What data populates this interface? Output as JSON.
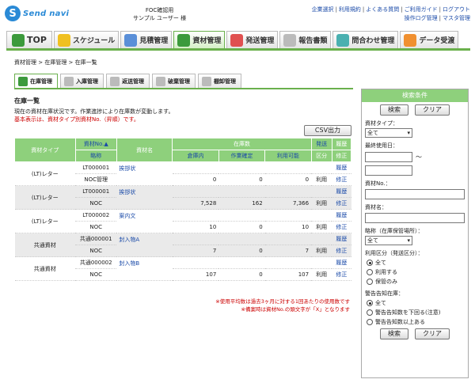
{
  "app": {
    "logo_mark": "S",
    "logo_text": "Send navi"
  },
  "user": {
    "line1": "FOC確認用",
    "line2": "サンプル ユーザー 様"
  },
  "toplinks": {
    "row1": [
      "企業選択",
      "利用規約",
      "よくある質問",
      "ご利用ガイド",
      "ログアウト"
    ],
    "row2": [
      "操作ログ管理",
      "マスタ管理"
    ]
  },
  "main_tabs": [
    "TOP",
    "スケジュール",
    "見積管理",
    "資材管理",
    "発送管理",
    "報告書類",
    "問合わせ管理",
    "データ受渡"
  ],
  "breadcrumb": "資材管理 > 在庫管理 > 在庫一覧",
  "sub_tabs": [
    "在庫管理",
    "入庫管理",
    "返送管理",
    "破棄管理",
    "棚卸管理"
  ],
  "section": {
    "title": "在庫一覧",
    "desc1": "現在の資材在庫状況です。作業進捗により在庫数が変動します。",
    "desc2": "基本表示は、資材タイプ別資材No.（昇順）です。",
    "csv_label": "CSV出力"
  },
  "table": {
    "h_type": "資材タイプ",
    "h_no": "資材No.▲",
    "h_abbr": "略称",
    "h_name": "資材名",
    "h_stock": "在庫数",
    "h_warehouse": "倉庫内",
    "h_confirmed": "作業確定",
    "h_available": "利用可能",
    "h_ship1": "発送",
    "h_ship2": "区分",
    "h_hist1": "履歴",
    "h_hist2": "修正",
    "rows": [
      {
        "type": "(LT)レター",
        "no": "LT000001",
        "abbr": "NOC管理",
        "name": "挨拶状",
        "warehouse": "0",
        "confirmed": "0",
        "available": "0",
        "ship": "利用",
        "hist": "履歴",
        "edit": "修正"
      },
      {
        "type": "(LT)レター",
        "no": "LT000001",
        "abbr": "NOC",
        "name": "挨拶状",
        "warehouse": "7,528",
        "confirmed": "162",
        "available": "7,366",
        "ship": "利用",
        "hist": "履歴",
        "edit": "修正"
      },
      {
        "type": "(LT)レター",
        "no": "LT000002",
        "abbr": "NOC",
        "name": "案内文",
        "warehouse": "10",
        "confirmed": "0",
        "available": "10",
        "ship": "利用",
        "hist": "履歴",
        "edit": "修正"
      },
      {
        "type": "共通資材",
        "no": "共通000001",
        "abbr": "NOC",
        "name": "封入物A",
        "warehouse": "7",
        "confirmed": "0",
        "available": "7",
        "ship": "利用",
        "hist": "履歴",
        "edit": "修正"
      },
      {
        "type": "共通資材",
        "no": "共通000002",
        "abbr": "NOC",
        "name": "封入物B",
        "warehouse": "107",
        "confirmed": "0",
        "available": "107",
        "ship": "利用",
        "hist": "履歴",
        "edit": "修正"
      }
    ]
  },
  "footnote": {
    "line1": "※使用平均数は過去3ヶ月に対する1回あたりの使用数です",
    "line2": "※備案時は資材No.の頭文字が「X」となります"
  },
  "side": {
    "title": "検索条件",
    "search": "検索",
    "clear": "クリア",
    "type_label": "資材タイプ：",
    "type_value": "全て",
    "lastuse_label": "最終使用日：",
    "tilde": "～",
    "no_label": "資材No.：",
    "name_label": "資材名：",
    "abbr_label": "略称（在庫保管場所）：",
    "abbr_value": "全て",
    "use_label": "利用区分（発送区分）：",
    "use_opts": [
      "全て",
      "利用する",
      "保管のみ"
    ],
    "alert_label": "警告告知在庫：",
    "alert_opts": [
      "全て",
      "警告告知数を下回る(注意)",
      "警告告知数以上ある"
    ]
  }
}
